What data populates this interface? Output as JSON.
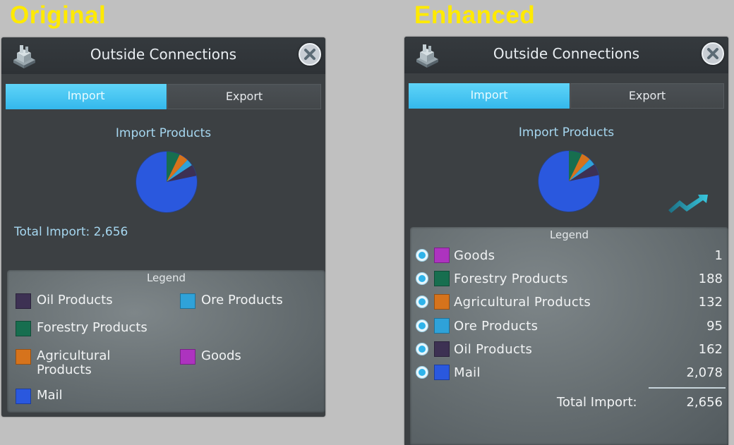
{
  "headings": {
    "original": "Original",
    "enhanced": "Enhanced"
  },
  "original": {
    "title": "Outside Connections",
    "tabs": {
      "import": "Import",
      "export": "Export"
    },
    "section_title": "Import Products",
    "total_text": "Total Import: 2,656",
    "legend": {
      "title": "Legend",
      "items": [
        {
          "label": "Oil Products",
          "color": "#3d3153"
        },
        {
          "label": "Ore Products",
          "color": "#2fa2d9"
        },
        {
          "label": "Forestry Products",
          "color": "#176e4f"
        },
        {
          "label": "Agricultural Products",
          "color": "#d6731c"
        },
        {
          "label": "Goods",
          "color": "#ad33bf"
        },
        {
          "label": "Mail",
          "color": "#2a58de"
        }
      ]
    }
  },
  "enhanced": {
    "title": "Outside Connections",
    "tabs": {
      "import": "Import",
      "export": "Export"
    },
    "section_title": "Import Products",
    "trend_icon": "trend-up-icon",
    "legend": {
      "title": "Legend",
      "rows": [
        {
          "label": "Goods",
          "value": "1",
          "color": "#ad33bf"
        },
        {
          "label": "Forestry Products",
          "value": "188",
          "color": "#176e4f"
        },
        {
          "label": "Agricultural Products",
          "value": "132",
          "color": "#d6731c"
        },
        {
          "label": "Ore Products",
          "value": "95",
          "color": "#2fa2d9"
        },
        {
          "label": "Oil Products",
          "value": "162",
          "color": "#3d3153"
        },
        {
          "label": "Mail",
          "value": "2,078",
          "color": "#2a58de"
        }
      ],
      "total_label": "Total Import:",
      "total_value": "2,656"
    }
  },
  "chart_data": [
    {
      "type": "pie",
      "title": "Import Products",
      "categories": [
        "Goods",
        "Forestry Products",
        "Agricultural Products",
        "Ore Products",
        "Oil Products",
        "Mail"
      ],
      "values": [
        1,
        188,
        132,
        95,
        162,
        2078
      ],
      "colors": [
        "#ad33bf",
        "#176e4f",
        "#d6731c",
        "#2fa2d9",
        "#3d3153",
        "#2a58de"
      ]
    }
  ]
}
